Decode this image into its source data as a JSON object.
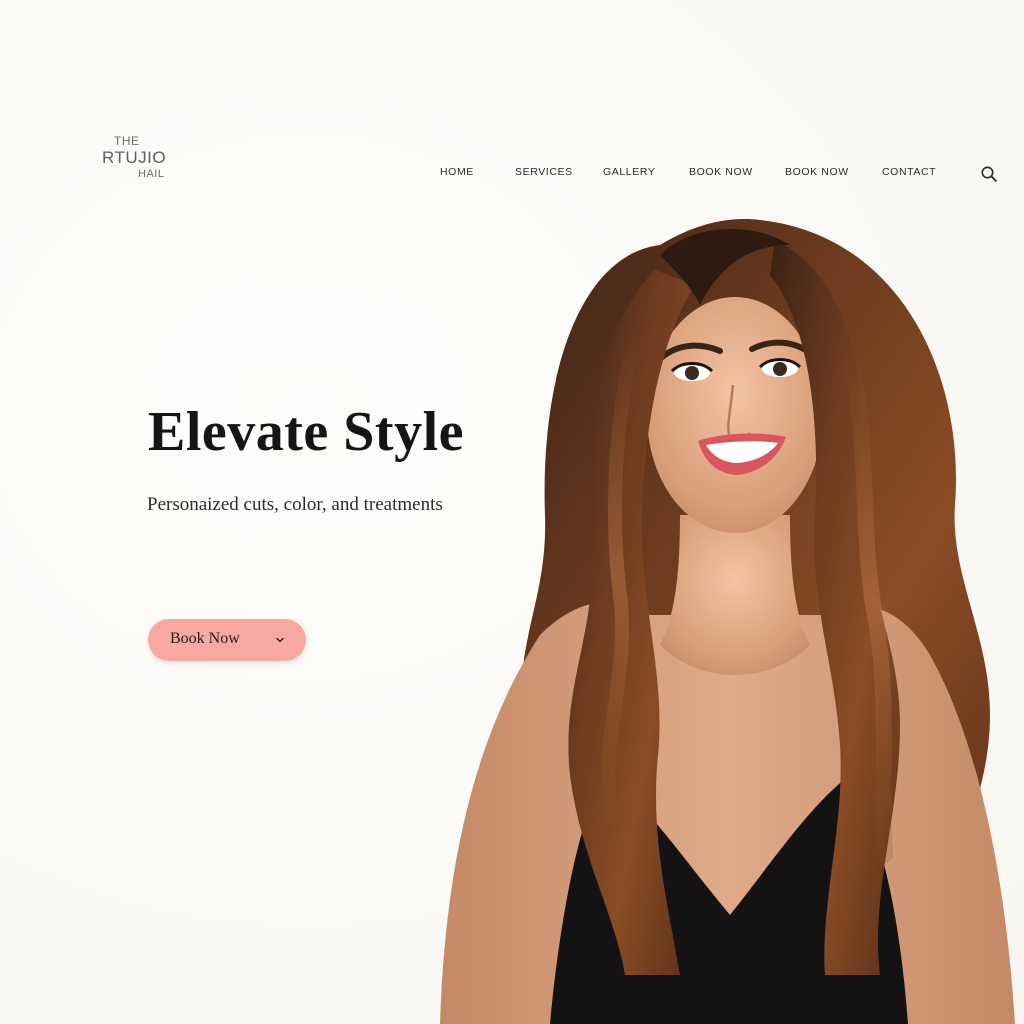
{
  "logo": {
    "line1": "THE",
    "line2": "RTUJIO",
    "line3": "HAIL"
  },
  "nav": {
    "items": [
      {
        "label": "HOME"
      },
      {
        "label": "SERVICES"
      },
      {
        "label": "GALLERY"
      },
      {
        "label": "BOOK NOW"
      },
      {
        "label": "BOOK NOW"
      },
      {
        "label": "CONTACT"
      }
    ],
    "search_icon": "search-icon"
  },
  "hero": {
    "title": "Elevate Style",
    "subtitle": "Personaized cuts, color, and treatments"
  },
  "cta": {
    "label": "Book Now",
    "icon": "chevron-down-icon"
  },
  "colors": {
    "background": "#fcfbf8",
    "cta_background": "#f7a8a0",
    "text_dark": "#151515",
    "hair": "#6b3a1f"
  }
}
